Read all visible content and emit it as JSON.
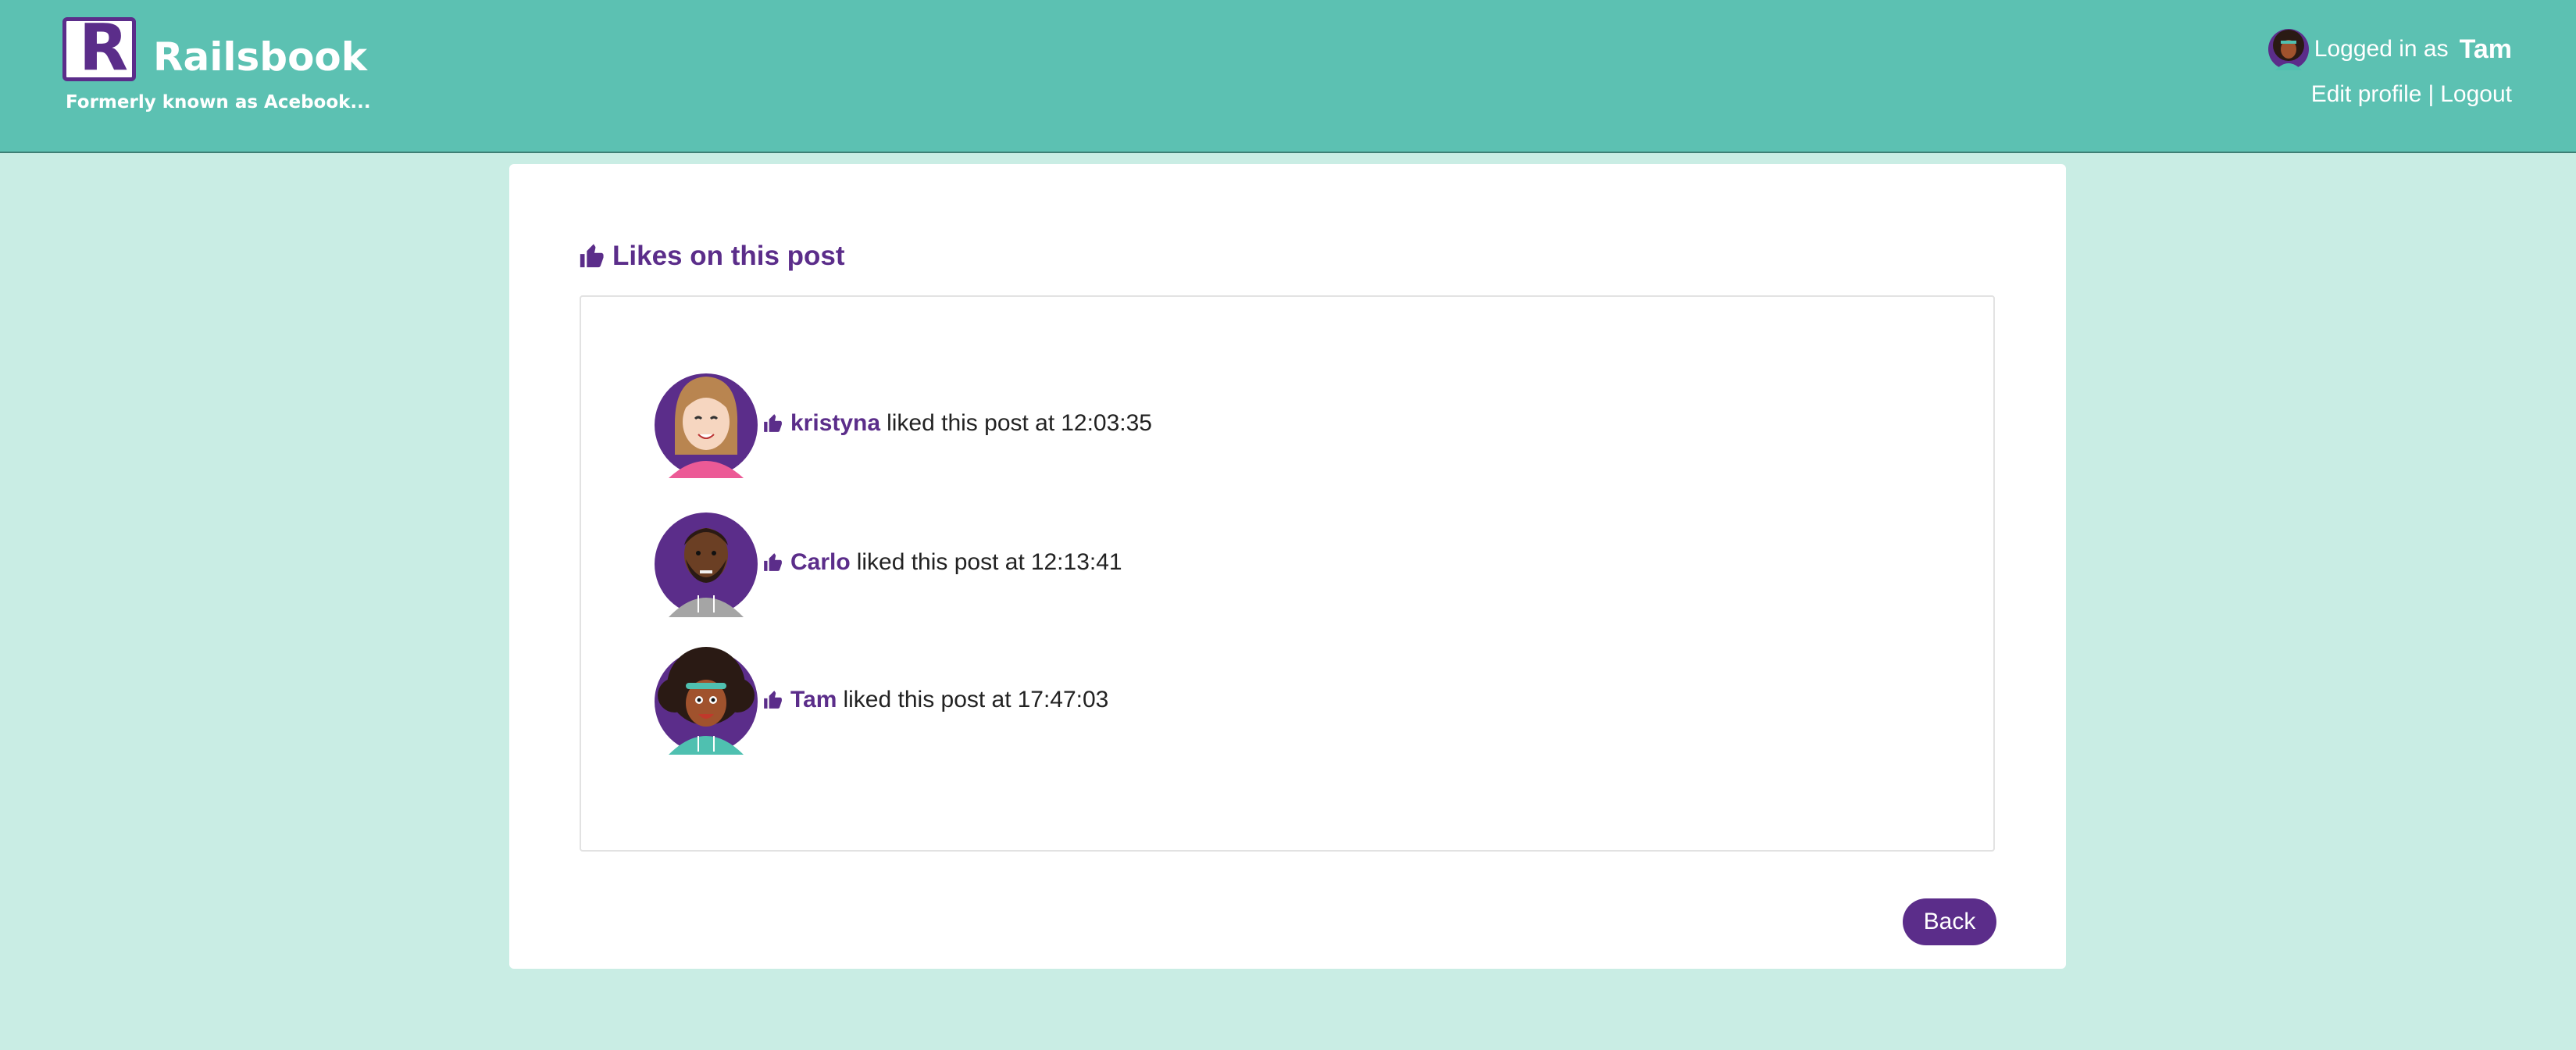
{
  "brand": {
    "logo_letter": "R",
    "name": "Railsbook",
    "tagline": "Formerly known as Acebook..."
  },
  "user": {
    "logged_in_prefix": "Logged in as",
    "name": "Tam",
    "edit_profile_label": "Edit profile",
    "separator": "|",
    "logout_label": "Logout"
  },
  "page": {
    "title": "Likes on this post",
    "back_label": "Back"
  },
  "likes": [
    {
      "name": "kristyna",
      "phrase": "liked this post at",
      "time": "12:03:35",
      "avatar": "female-light-avatar"
    },
    {
      "name": "Carlo",
      "phrase": "liked this post at",
      "time": "12:13:41",
      "avatar": "male-beard-avatar"
    },
    {
      "name": "Tam",
      "phrase": "liked this post at",
      "time": "17:47:03",
      "avatar": "female-curly-avatar"
    }
  ],
  "colors": {
    "header_bg": "#5cc1b2",
    "page_bg": "#c9ede4",
    "accent_purple": "#5b2d8a"
  }
}
